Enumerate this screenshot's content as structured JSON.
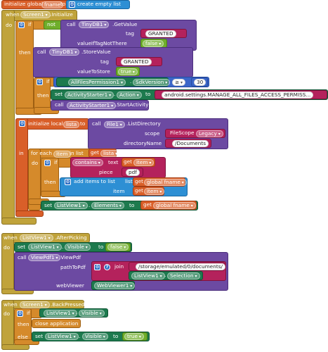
{
  "global_init": {
    "initialize_global": "initialize global",
    "name": "fname",
    "to": "to",
    "create_empty_list": "create empty list"
  },
  "initialize_event": {
    "when": "when",
    "component": "Screen1",
    "event": ".Initialize",
    "do": "do",
    "if_kw": "if",
    "not_kw": "not",
    "call_kw": "call",
    "tinydb": "TinyDB1",
    "getvalue": ".GetValue",
    "tag_lbl": "tag",
    "tag_val": "GRANTED",
    "valueIfTagNotThere_lbl": "valueIfTagNotThere",
    "false_val": "false",
    "then_kw": "then",
    "storevalue": ".StoreValue",
    "valueToStore_lbl": "valueToStore",
    "true_val": "true",
    "inner_if_kw": "if",
    "allfiles": "AllFilesPermission1",
    "sdkversion": "SdkVersion",
    "op": "≥",
    "op_val": "30",
    "set_kw": "set",
    "activitystarter": "ActivityStarter1",
    "action_prop": "Action",
    "to_kw": "to",
    "action_val": "android.settings.MANAGE_ALL_FILES_ACCESS_PERMISS...",
    "startactivity": ".StartActivity",
    "init_local": "initialize local",
    "local_name": "lista",
    "file1": "File1",
    "listdirectory": ".ListDirectory",
    "scope_lbl": "scope",
    "filescope": "FileScope",
    "legacy": "Legacy",
    "directoryName_lbl": "directoryName",
    "documents_val": "/Documents",
    "in_kw": "in",
    "foreach": "for each",
    "item_name": "item",
    "in_list": "in list",
    "get_kw": "get",
    "lista_ref": "lista",
    "contains": "contains",
    "text_kw": "text",
    "item_ref": "item",
    "piece_kw": "piece",
    "pdf_val": "pdf",
    "add_items": "add items to list",
    "list_kw": "list",
    "global_fname": "global fname",
    "item_kw": "item",
    "listview": "ListView1",
    "elements_prop": "Elements"
  },
  "afterpicking_event": {
    "when": "when",
    "component": "ListView1",
    "event": ".AfterPicking",
    "do": "do",
    "set_kw": "set",
    "listview": "ListView1",
    "visible_prop": "Visible",
    "to_kw": "to",
    "false_val": "false",
    "call_kw": "call",
    "viewpdf": "ViewPdf1",
    "viewpdf_method": ".ViewPdf",
    "pathToPdf_lbl": "pathToPdf",
    "join": "join",
    "storage_val": "/storage/emulated/0/documents/",
    "selection_prop": "Selection",
    "webViewer_lbl": "webViewer",
    "webviewer_val": "WebViewer1"
  },
  "backpressed_event": {
    "when": "when",
    "component": "Screen1",
    "event": ".BackPressed",
    "do": "do",
    "if_kw": "if",
    "listview": "ListView1",
    "visible_prop": "Visible",
    "then_kw": "then",
    "close_app": "close application",
    "else_kw": "else",
    "set_kw": "set",
    "to_kw": "to",
    "true_val": "true"
  }
}
